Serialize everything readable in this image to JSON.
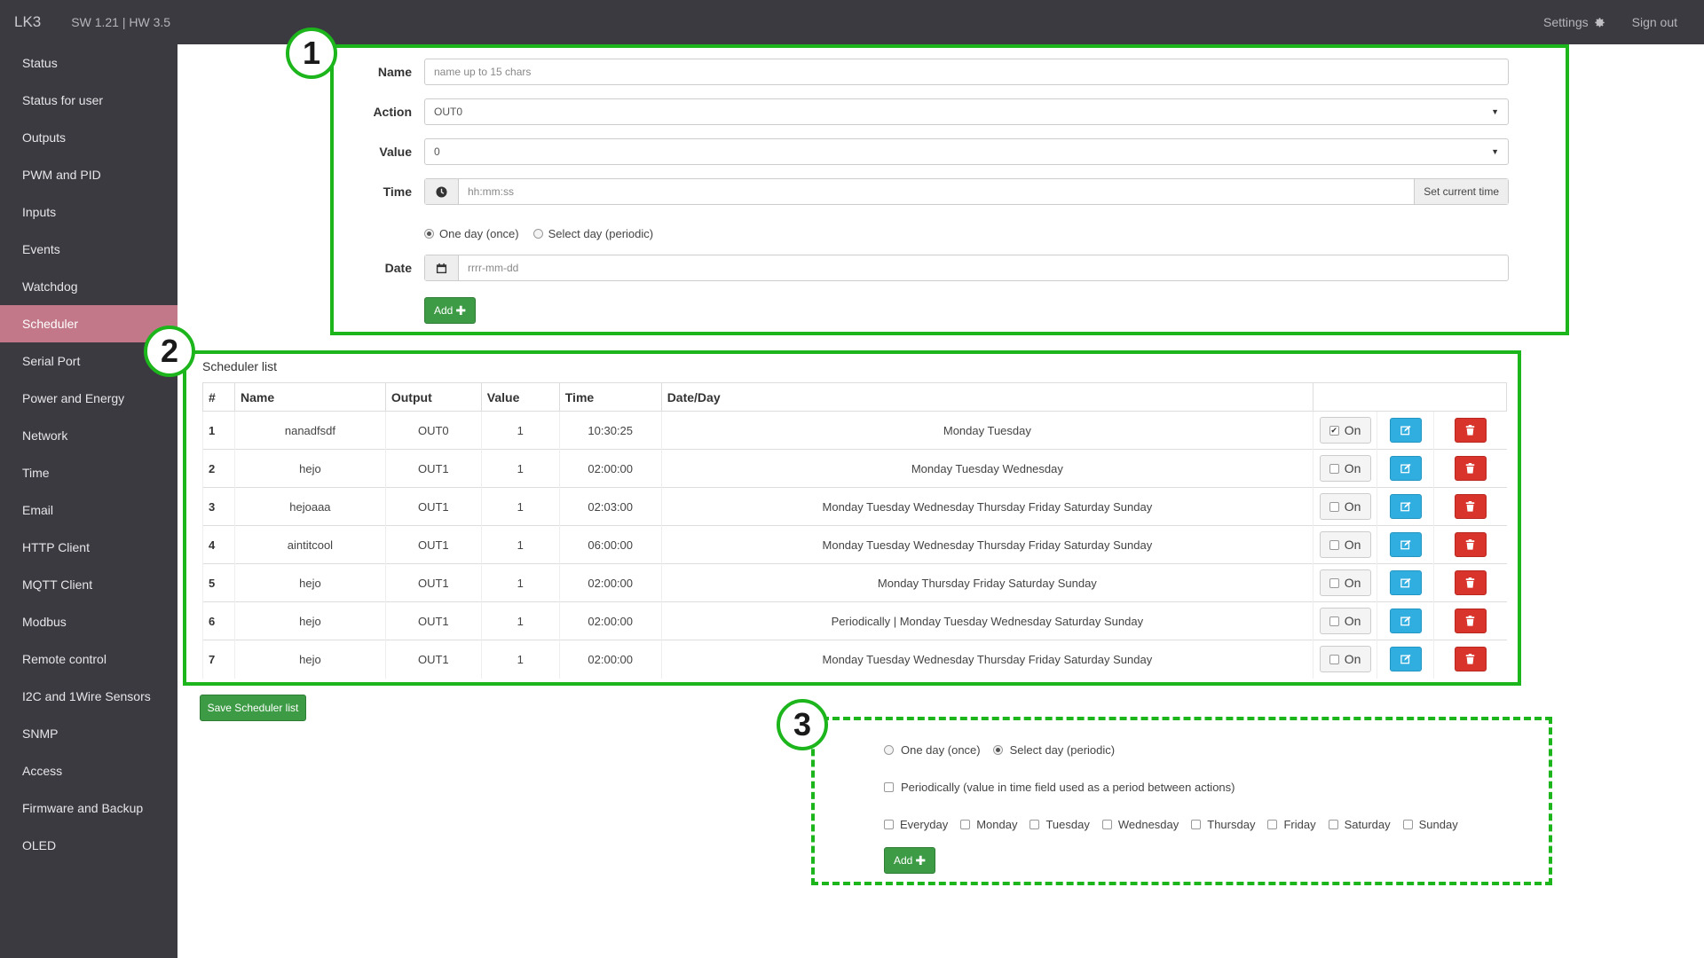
{
  "topbar": {
    "brand": "LK3",
    "version": "SW 1.21 | HW 3.5",
    "settings": "Settings",
    "signout": "Sign out"
  },
  "sidebar": {
    "items": [
      "Status",
      "Status for user",
      "Outputs",
      "PWM and PID",
      "Inputs",
      "Events",
      "Watchdog",
      "Scheduler",
      "Serial Port",
      "Power and Energy",
      "Network",
      "Time",
      "Email",
      "HTTP Client",
      "MQTT Client",
      "Modbus",
      "Remote control",
      "I2C and 1Wire Sensors",
      "SNMP",
      "Access",
      "Firmware and Backup",
      "OLED"
    ],
    "active": "Scheduler"
  },
  "annotations": {
    "one": "1",
    "two": "2",
    "three": "3"
  },
  "form": {
    "name_label": "Name",
    "name_placeholder": "name up to 15 chars",
    "action_label": "Action",
    "action_value": "OUT0",
    "value_label": "Value",
    "value_value": "0",
    "time_label": "Time",
    "time_placeholder": "hh:mm:ss",
    "set_time": "Set current time",
    "radio_once": "One day (once)",
    "radio_periodic": "Select day (periodic)",
    "date_label": "Date",
    "date_placeholder": "rrrr-mm-dd",
    "add": "Add"
  },
  "list": {
    "title": "Scheduler list",
    "headers": [
      "#",
      "Name",
      "Output",
      "Value",
      "Time",
      "Date/Day",
      ""
    ],
    "rows": [
      {
        "idx": "1",
        "name": "nanadfsdf",
        "output": "OUT0",
        "value": "1",
        "time": "10:30:25",
        "days": "Monday Tuesday",
        "on": true
      },
      {
        "idx": "2",
        "name": "hejo",
        "output": "OUT1",
        "value": "1",
        "time": "02:00:00",
        "days": "Monday Tuesday Wednesday",
        "on": false
      },
      {
        "idx": "3",
        "name": "hejoaaa",
        "output": "OUT1",
        "value": "1",
        "time": "02:03:00",
        "days": "Monday Tuesday Wednesday Thursday Friday Saturday Sunday",
        "on": false
      },
      {
        "idx": "4",
        "name": "aintitcool",
        "output": "OUT1",
        "value": "1",
        "time": "06:00:00",
        "days": "Monday Tuesday Wednesday Thursday Friday Saturday Sunday",
        "on": false
      },
      {
        "idx": "5",
        "name": "hejo",
        "output": "OUT1",
        "value": "1",
        "time": "02:00:00",
        "days": "Monday Thursday Friday Saturday Sunday",
        "on": false
      },
      {
        "idx": "6",
        "name": "hejo",
        "output": "OUT1",
        "value": "1",
        "time": "02:00:00",
        "days": "Periodically | Monday Tuesday Wednesday Saturday Sunday",
        "on": false
      },
      {
        "idx": "7",
        "name": "hejo",
        "output": "OUT1",
        "value": "1",
        "time": "02:00:00",
        "days": "Monday Tuesday Wednesday Thursday Friday Saturday Sunday",
        "on": false
      }
    ],
    "on_label": "On",
    "save": "Save Scheduler list"
  },
  "periodic": {
    "radio_once": "One day (once)",
    "radio_periodic": "Select day (periodic)",
    "periodically": "Periodically (value in time field used as a period between actions)",
    "days": [
      "Everyday",
      "Monday",
      "Tuesday",
      "Wednesday",
      "Thursday",
      "Friday",
      "Saturday",
      "Sunday"
    ],
    "add": "Add"
  },
  "colors": {
    "accent_green": "#1cb51c",
    "sidebar_bg": "#3a3a40",
    "active_item": "#c27889",
    "edit_blue": "#31aee0",
    "delete_red": "#d9342b"
  }
}
